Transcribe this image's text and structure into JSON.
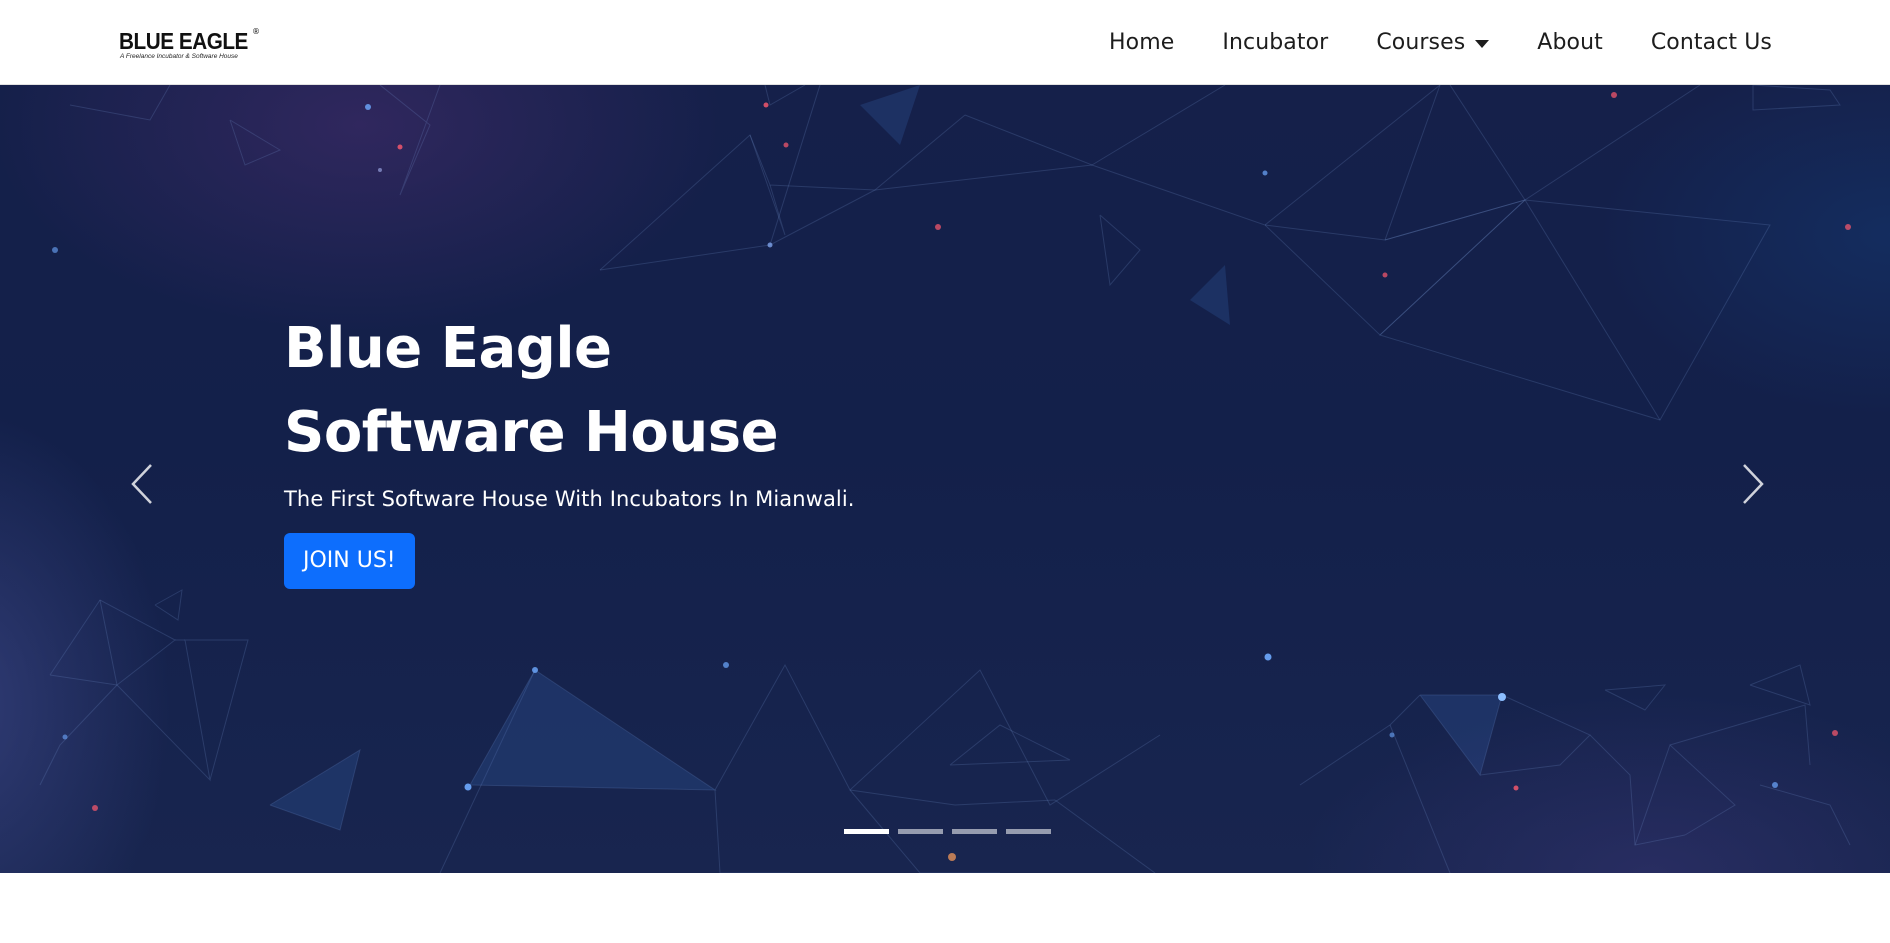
{
  "brand": {
    "name": "BLUE EAGLE",
    "registered_mark": "®",
    "tagline": "A Freelance Incubator & Software House"
  },
  "nav": {
    "items": [
      {
        "label": "Home"
      },
      {
        "label": "Incubator"
      },
      {
        "label": "Courses",
        "has_dropdown": true,
        "icon": "caret-down-icon"
      },
      {
        "label": "About"
      },
      {
        "label": "Contact Us"
      }
    ]
  },
  "hero": {
    "title_line1": "Blue Eagle",
    "title_line2": "Software House",
    "subtitle": "The First Software House With Incubators In Mianwali.",
    "cta_label": "JOIN US!",
    "prev_icon": "chevron-left-icon",
    "next_icon": "chevron-right-icon",
    "slides_total": 4,
    "active_slide": 1
  },
  "colors": {
    "hero_background": "#13204a",
    "cta_background": "#0d6efd",
    "text_on_hero": "#ffffff",
    "nav_text": "#1d1d1d"
  }
}
